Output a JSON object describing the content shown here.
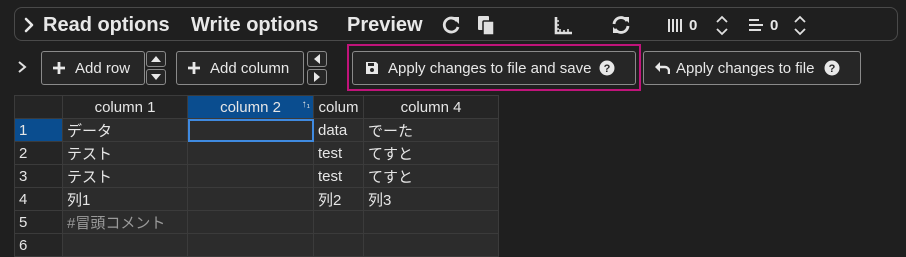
{
  "toolbar": {
    "read_options": "Read options",
    "write_options": "Write options",
    "preview": "Preview",
    "col_count": "0",
    "row_count": "0"
  },
  "actions": {
    "add_row": "Add row",
    "add_column": "Add column",
    "apply_and_save": "Apply changes to file and save",
    "apply": "Apply changes to file"
  },
  "grid": {
    "columns": [
      "column 1",
      "column 2",
      "colum",
      "column 4"
    ],
    "selected_column": 1,
    "row_numbers": [
      "1",
      "2",
      "3",
      "4",
      "5",
      "6"
    ],
    "rows": [
      [
        "データ",
        "",
        "data",
        "でーた"
      ],
      [
        "テスト",
        "",
        "test",
        "てすと"
      ],
      [
        "テスト",
        "",
        "test",
        "てすと"
      ],
      [
        "列1",
        "",
        "列2",
        "列3"
      ],
      [
        "#冒頭コメント",
        "",
        "",
        ""
      ],
      [
        "",
        "",
        "",
        ""
      ]
    ]
  },
  "colors": {
    "accent_selected": "#0a4d8f",
    "highlight_border": "#c0147a",
    "active_cell_border": "#3f8ae0"
  }
}
